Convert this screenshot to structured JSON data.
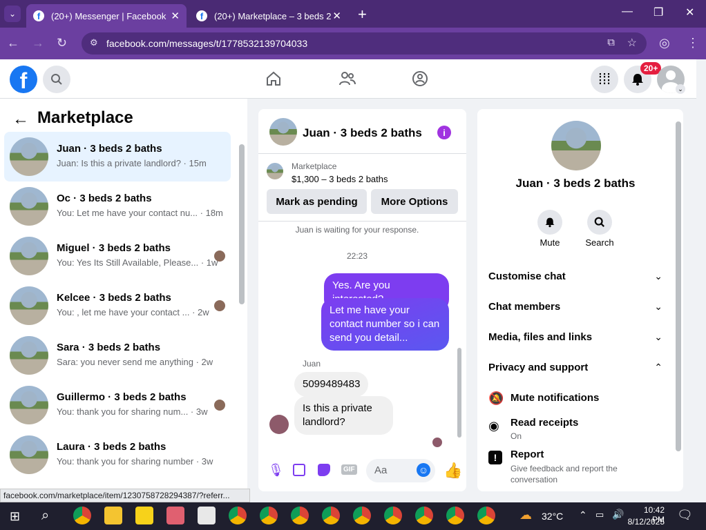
{
  "browser": {
    "tabs": [
      {
        "title": "(20+) Messenger | Facebook",
        "active": true
      },
      {
        "title": "(20+) Marketplace – 3 beds 2 b",
        "active": false
      }
    ],
    "url": "facebook.com/messages/t/1778532139704033",
    "status_url": "facebook.com/marketplace/item/1230758728294387/?referr..."
  },
  "header": {
    "notification_badge": "20+"
  },
  "left": {
    "title": "Marketplace",
    "conversations": [
      {
        "name": "Juan · 3 beds 2 baths",
        "preview": "Juan: Is this a private landlord? · 15m",
        "active": true
      },
      {
        "name": "Oc · 3 beds 2 baths",
        "preview": "You: Let me have your contact nu... · 18m",
        "active": false
      },
      {
        "name": "Miguel · 3 beds 2 baths",
        "preview": "You: Yes Its Still Available, Please... · 1w",
        "active": false
      },
      {
        "name": "Kelcee · 3 beds 2 baths",
        "preview": "You: , let me have your contact ... · 2w",
        "active": false
      },
      {
        "name": "Sara · 3 beds 2 baths",
        "preview": "Sara: you never send me anything · 2w",
        "active": false
      },
      {
        "name": "Guillermo · 3 beds 2 baths",
        "preview": "You: thank you for sharing num... · 3w",
        "active": false
      },
      {
        "name": "Laura · 3 beds 2 baths",
        "preview": "You: thank you for sharing number · 3w",
        "active": false
      }
    ]
  },
  "chat": {
    "title": "Juan · 3 beds 2 baths",
    "listing_label": "Marketplace",
    "listing_price": "$1,300 – 3 beds 2 baths",
    "mark_pending": "Mark as pending",
    "more_options": "More Options",
    "waiting": "Juan is waiting for your response.",
    "time": "22:23",
    "out1": "Yes. Are you interested?",
    "out2": "Let me have your contact number so i can send you detail...",
    "sender": "Juan",
    "in1": "5099489483",
    "in2": "Is this a private landlord?",
    "input_placeholder": "Aa"
  },
  "right": {
    "name": "Juan · 3 beds 2 baths",
    "mute": "Mute",
    "search": "Search",
    "sections": [
      "Customise chat",
      "Chat members",
      "Media, files and links",
      "Privacy and support"
    ],
    "mute_notifications": "Mute notifications",
    "read_receipts": "Read receipts",
    "read_receipts_state": "On",
    "report": "Report",
    "report_sub": "Give feedback and report the conversation"
  },
  "taskbar": {
    "temperature": "32°C",
    "time": "10:42 PM",
    "date": "8/12/2025"
  },
  "colors": {
    "accent": "#7d3df0",
    "facebook_blue": "#1877f2",
    "browser_purple": "#6b3fa0"
  }
}
